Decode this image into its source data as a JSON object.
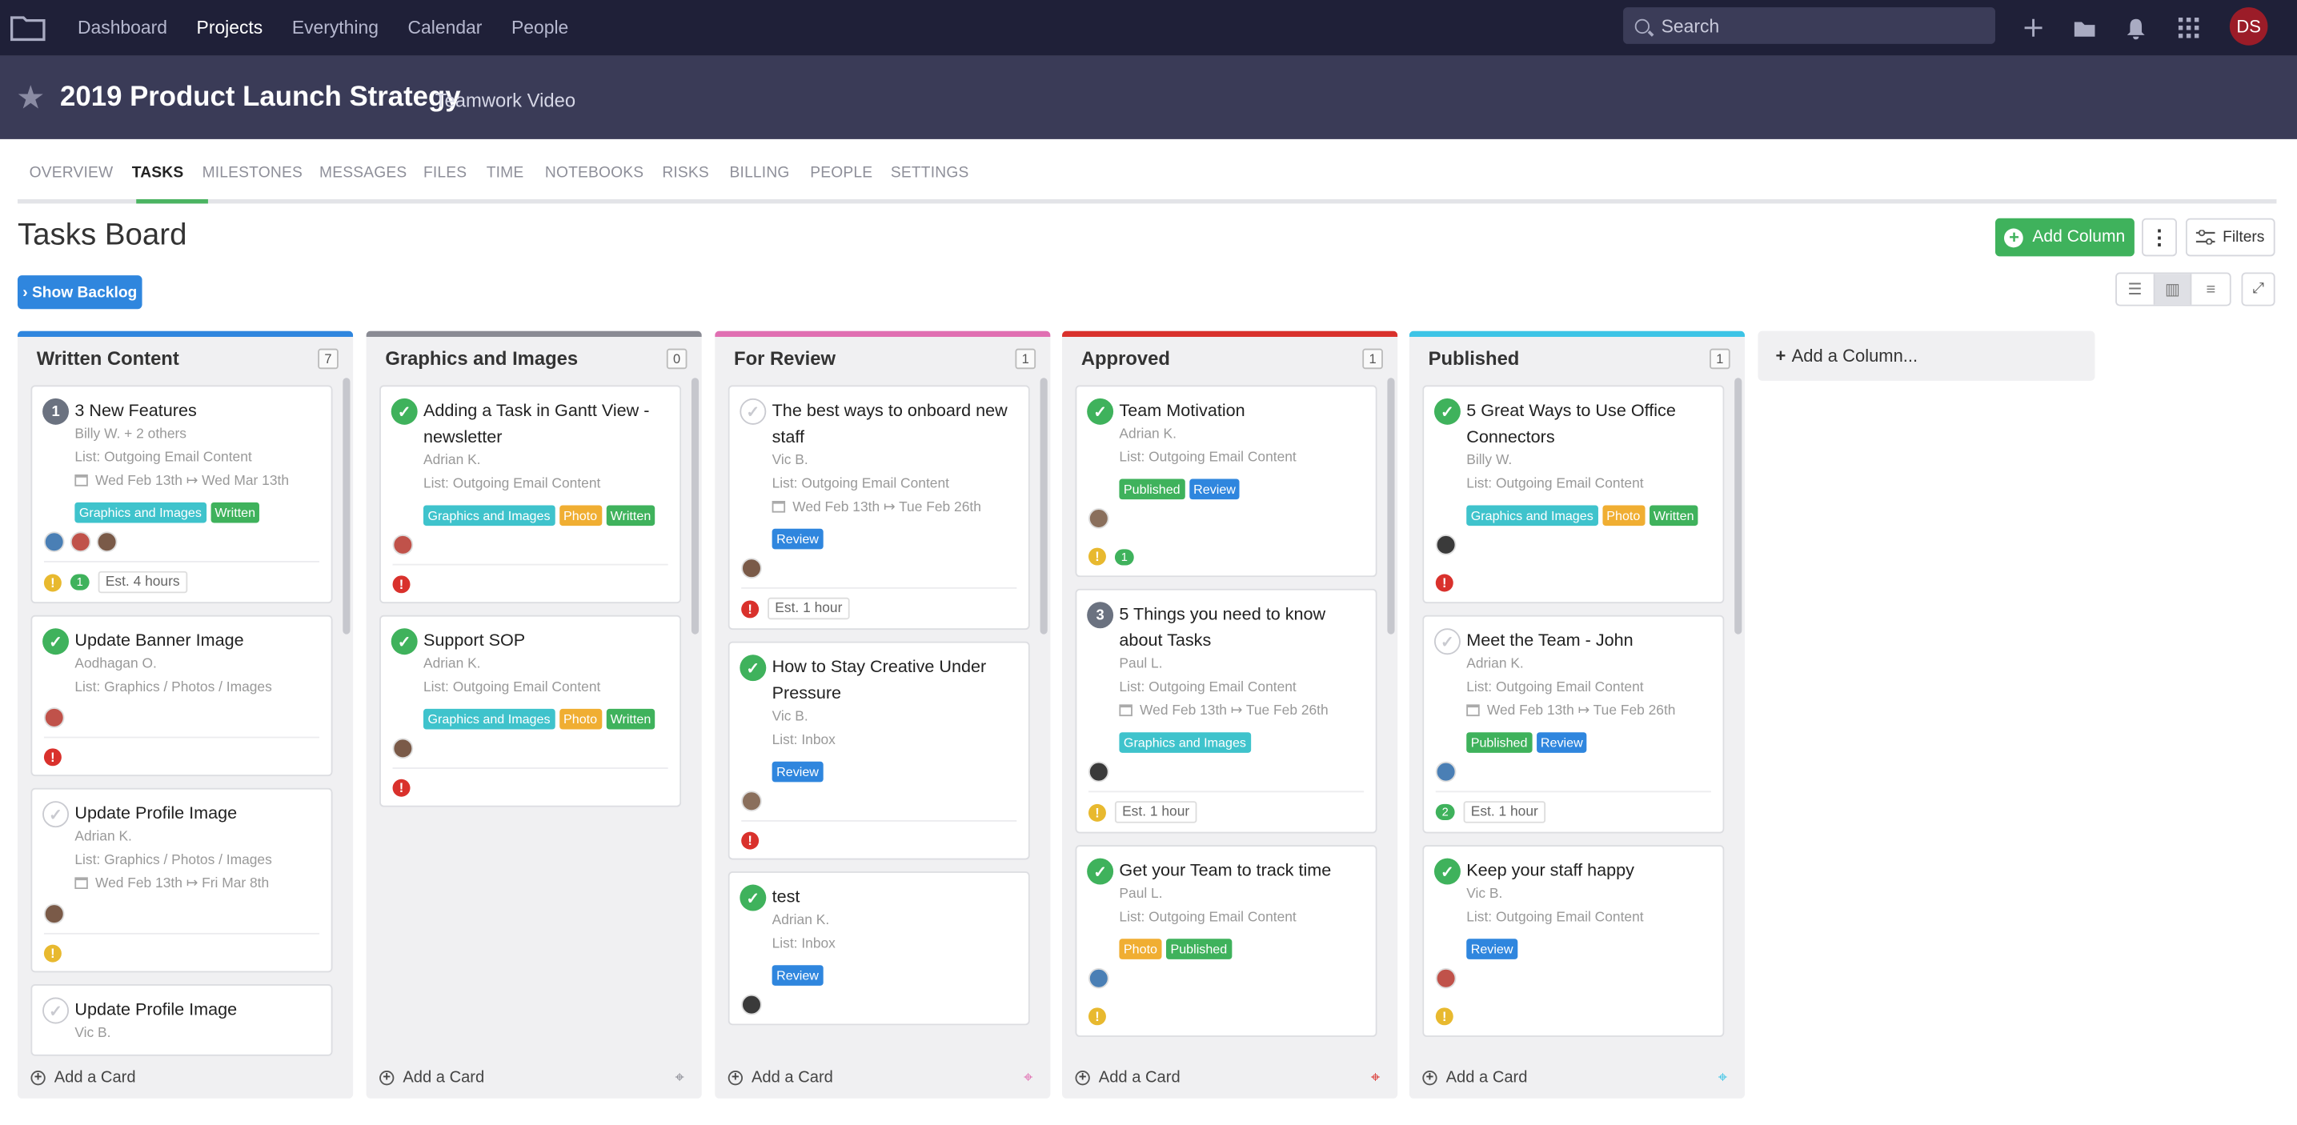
{
  "nav": {
    "items": [
      "Dashboard",
      "Projects",
      "Everything",
      "Calendar",
      "People"
    ],
    "active": "Projects",
    "search_placeholder": "Search",
    "user_initials": "DS"
  },
  "project": {
    "title": "2019 Product Launch Strategy",
    "company": "Teamwork Video"
  },
  "tabs": [
    "OVERVIEW",
    "TASKS",
    "MILESTONES",
    "MESSAGES",
    "FILES",
    "TIME",
    "NOTEBOOKS",
    "RISKS",
    "BILLING",
    "PEOPLE",
    "SETTINGS"
  ],
  "active_tab": "TASKS",
  "board": {
    "title": "Tasks Board",
    "show_backlog": "› Show Backlog",
    "add_column": "Add Column",
    "filters": "Filters",
    "add_column_placeholder": "Add a Column...",
    "add_card": "Add a Card"
  },
  "colors": {
    "accent": "#3fb25c",
    "blue": "#2f86de",
    "nav_bg": "#1f2038",
    "header_bg": "#3a3b57"
  },
  "columns": [
    {
      "title": "Written Content",
      "count": "7",
      "color": "#2f86de",
      "cards": [
        {
          "status": "num",
          "num": "1",
          "title": "3 New Features",
          "assignee": "Billy W. + 2 others",
          "list": "List: Outgoing Email Content",
          "date": "Wed Feb 13th ↦ Wed Mar 13th",
          "tags": [
            "Graphics and Images",
            "Written"
          ],
          "avatars": 3,
          "foot": {
            "warn": true,
            "comment": "1",
            "est": "Est. 4 hours"
          }
        },
        {
          "status": "done",
          "title": "Update Banner Image",
          "assignee": "Aodhagan O.",
          "list": "List: Graphics / Photos / Images",
          "avatars": 1,
          "foot": {
            "alert": true
          }
        },
        {
          "status": "open",
          "title": "Update Profile Image",
          "assignee": "Adrian K.",
          "list": "List: Graphics / Photos / Images",
          "date": "Wed Feb 13th ↦ Fri Mar 8th",
          "avatars": 1,
          "foot": {
            "warn": true
          }
        },
        {
          "status": "open",
          "title": "Update Profile Image",
          "assignee": "Vic B."
        }
      ]
    },
    {
      "title": "Graphics and Images",
      "count": "0",
      "color": "#8a8b94",
      "cards": [
        {
          "status": "done",
          "title": "Adding a Task in Gantt View - newsletter",
          "assignee": "Adrian K.",
          "list": "List: Outgoing Email Content",
          "tags": [
            "Graphics and Images",
            "Photo",
            "Written"
          ],
          "avatars": 1,
          "foot": {
            "alert": true
          }
        },
        {
          "status": "done",
          "title": "Support SOP",
          "assignee": "Adrian K.",
          "list": "List: Outgoing Email Content",
          "tags": [
            "Graphics and Images",
            "Photo",
            "Written"
          ],
          "avatars": 1,
          "foot": {
            "alert": true
          }
        }
      ]
    },
    {
      "title": "For Review",
      "count": "1",
      "color": "#e06fb2",
      "cards": [
        {
          "status": "open",
          "title": "The best ways to onboard new staff",
          "assignee": "Vic B.",
          "list": "List: Outgoing Email Content",
          "date": "Wed Feb 13th ↦ Tue Feb 26th",
          "tags": [
            "Review"
          ],
          "avatars": 1,
          "foot": {
            "alert": true,
            "est": "Est. 1 hour"
          }
        },
        {
          "status": "done",
          "title": "How to Stay Creative Under Pressure",
          "assignee": "Vic B.",
          "list": "List: Inbox",
          "tags": [
            "Review"
          ],
          "avatars": 1,
          "foot": {
            "alert": true
          }
        },
        {
          "status": "done",
          "title": "test",
          "assignee": "Adrian K.",
          "list": "List: Inbox",
          "tags": [
            "Review"
          ],
          "avatars": 1
        }
      ]
    },
    {
      "title": "Approved",
      "count": "1",
      "color": "#d9312c",
      "cards": [
        {
          "status": "done",
          "title": "Team Motivation",
          "assignee": "Adrian K.",
          "list": "List: Outgoing Email Content",
          "tags": [
            "Published",
            "Review"
          ],
          "avatars": 1,
          "foot": {
            "warn": true,
            "comment": "1",
            "noborder": true
          }
        },
        {
          "status": "num",
          "num": "3",
          "title": "5 Things you need to know about Tasks",
          "assignee": "Paul L.",
          "list": "List: Outgoing Email Content",
          "date": "Wed Feb 13th ↦ Tue Feb 26th",
          "tags": [
            "Graphics and Images"
          ],
          "avatars": 1,
          "foot": {
            "warn": true,
            "est": "Est. 1 hour"
          }
        },
        {
          "status": "done",
          "title": "Get your Team to track time",
          "assignee": "Paul L.",
          "list": "List: Outgoing Email Content",
          "tags": [
            "Photo",
            "Published"
          ],
          "avatars": 1,
          "foot": {
            "warn": true,
            "noborder": true
          }
        }
      ]
    },
    {
      "title": "Published",
      "count": "1",
      "color": "#3dc4e6",
      "cards": [
        {
          "status": "done",
          "title": "5 Great Ways to Use Office Connectors",
          "assignee": "Billy W.",
          "list": "List: Outgoing Email Content",
          "tags": [
            "Graphics and Images",
            "Photo",
            "Written"
          ],
          "avatars": 1,
          "foot": {
            "alert": true,
            "noborder": true
          }
        },
        {
          "status": "open",
          "title": "Meet the Team - John",
          "assignee": "Adrian K.",
          "list": "List: Outgoing Email Content",
          "date": "Wed Feb 13th ↦ Tue Feb 26th",
          "tags": [
            "Published",
            "Review"
          ],
          "avatars": 1,
          "foot": {
            "comment": "2",
            "est": "Est. 1 hour"
          }
        },
        {
          "status": "done",
          "title": "Keep your staff happy",
          "assignee": "Vic B.",
          "list": "List: Outgoing Email Content",
          "tags": [
            "Review"
          ],
          "avatars": 1,
          "foot": {
            "warn": true,
            "noborder": true
          }
        }
      ]
    }
  ]
}
